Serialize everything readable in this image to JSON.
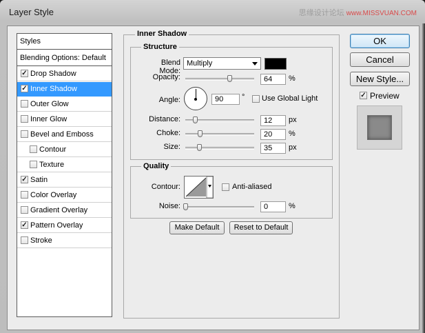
{
  "window": {
    "title": "Layer Style"
  },
  "watermark": {
    "line1": "思缘设计论坛",
    "line2": "www.MISSVUAN.COM"
  },
  "sidebar": {
    "items": [
      {
        "label": "Styles",
        "type": "header"
      },
      {
        "label": "Blending Options: Default",
        "type": "header"
      },
      {
        "label": "Drop Shadow",
        "checked": true
      },
      {
        "label": "Inner Shadow",
        "checked": true,
        "selected": true
      },
      {
        "label": "Outer Glow",
        "checked": false
      },
      {
        "label": "Inner Glow",
        "checked": false
      },
      {
        "label": "Bevel and Emboss",
        "checked": false
      },
      {
        "label": "Contour",
        "checked": false
      },
      {
        "label": "Texture",
        "checked": false
      },
      {
        "label": "Satin",
        "checked": true
      },
      {
        "label": "Color Overlay",
        "checked": false
      },
      {
        "label": "Gradient Overlay",
        "checked": false
      },
      {
        "label": "Pattern Overlay",
        "checked": true
      },
      {
        "label": "Stroke",
        "checked": false
      }
    ]
  },
  "inner_shadow": {
    "title": "Inner Shadow",
    "structure": {
      "title": "Structure",
      "blend_mode_label": "Blend Mode:",
      "blend_mode_value": "Multiply",
      "shadow_color": "#000000",
      "opacity_label": "Opacity:",
      "opacity_value": "64",
      "opacity_unit": "%",
      "opacity_fraction": 0.64,
      "angle_label": "Angle:",
      "angle_value": "90",
      "angle_unit": "°",
      "use_global_light_label": "Use Global Light",
      "use_global_light": false,
      "distance_label": "Distance:",
      "distance_value": "12",
      "distance_unit": "px",
      "choke_label": "Choke:",
      "choke_value": "20",
      "choke_unit": "%",
      "size_label": "Size:",
      "size_value": "35",
      "size_unit": "px"
    },
    "quality": {
      "title": "Quality",
      "contour_label": "Contour:",
      "anti_aliased_label": "Anti-aliased",
      "anti_aliased": false,
      "noise_label": "Noise:",
      "noise_value": "0",
      "noise_unit": "%"
    },
    "make_default_label": "Make Default",
    "reset_default_label": "Reset to Default"
  },
  "actions": {
    "ok_label": "OK",
    "cancel_label": "Cancel",
    "new_style_label": "New Style...",
    "preview_label": "Preview",
    "preview_checked": true
  }
}
